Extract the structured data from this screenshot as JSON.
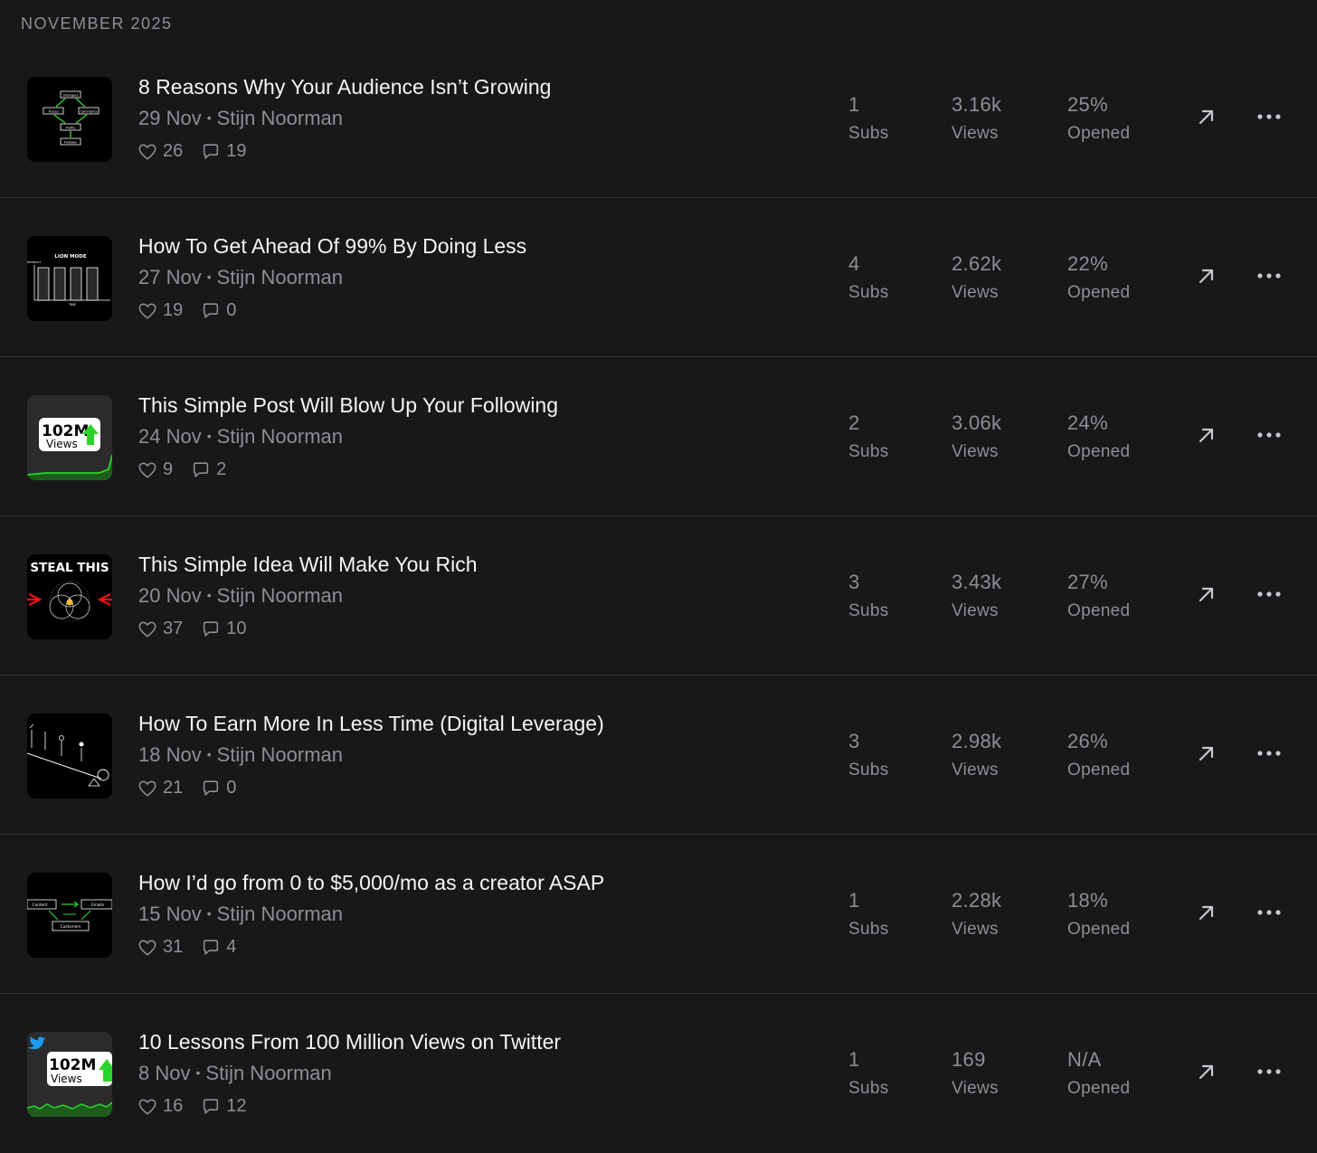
{
  "section": {
    "header": "NOVEMBER 2025"
  },
  "labels": {
    "subs": "Subs",
    "views": "Views",
    "opened": "Opened",
    "separator": "•"
  },
  "colors": {
    "background": "#18181a",
    "muted": "#8e8e93",
    "accent_green": "#2ad42a",
    "twitter_blue": "#1d9bf0"
  },
  "posts": [
    {
      "title": "8 Reasons Why Your Audience Isn’t Growing",
      "date": "29 Nov",
      "author": "Stijn Noorman",
      "likes": "26",
      "comments": "19",
      "subs": "1",
      "views": "3.16k",
      "opened": "25%",
      "thumbnail": "flowchart-thumbnail",
      "thumb_labels": [
        "Strangers",
        "Traces",
        "Comments",
        "Profile",
        "Follower"
      ]
    },
    {
      "title": "How To Get Ahead Of 99% By Doing Less",
      "date": "27 Nov",
      "author": "Stijn Noorman",
      "likes": "19",
      "comments": "0",
      "subs": "4",
      "views": "2.62k",
      "opened": "22%",
      "thumbnail": "lion-mode-bars-thumbnail",
      "thumb_labels": [
        "LION MODE",
        "INTENSITY",
        "TIME"
      ]
    },
    {
      "title": "This Simple Post Will Blow Up Your Following",
      "date": "24 Nov",
      "author": "Stijn Noorman",
      "likes": "9",
      "comments": "2",
      "subs": "2",
      "views": "3.06k",
      "opened": "24%",
      "thumbnail": "views-growth-thumbnail",
      "thumb_labels": [
        "102M",
        "Views"
      ]
    },
    {
      "title": "This Simple Idea Will Make You Rich",
      "date": "20 Nov",
      "author": "Stijn Noorman",
      "likes": "37",
      "comments": "10",
      "subs": "3",
      "views": "3.43k",
      "opened": "27%",
      "thumbnail": "steal-this-venn-thumbnail",
      "thumb_labels": [
        "STEAL THIS"
      ]
    },
    {
      "title": "How To Earn More In Less Time (Digital Leverage)",
      "date": "18 Nov",
      "author": "Stijn Noorman",
      "likes": "21",
      "comments": "0",
      "subs": "3",
      "views": "2.98k",
      "opened": "26%",
      "thumbnail": "leverage-seesaw-thumbnail",
      "thumb_labels": []
    },
    {
      "title": "How I’d go from 0 to $5,000/mo as a creator ASAP",
      "date": "15 Nov",
      "author": "Stijn Noorman",
      "likes": "31",
      "comments": "4",
      "subs": "1",
      "views": "2.28k",
      "opened": "18%",
      "thumbnail": "content-emails-customers-thumbnail",
      "thumb_labels": [
        "Content",
        "Emails",
        "Customers"
      ]
    },
    {
      "title": "10 Lessons From 100 Million Views on Twitter",
      "date": "8 Nov",
      "author": "Stijn Noorman",
      "likes": "16",
      "comments": "12",
      "subs": "1",
      "views": "169",
      "opened": "N/A",
      "thumbnail": "twitter-views-thumbnail",
      "thumb_labels": [
        "102M",
        "Views"
      ]
    }
  ]
}
